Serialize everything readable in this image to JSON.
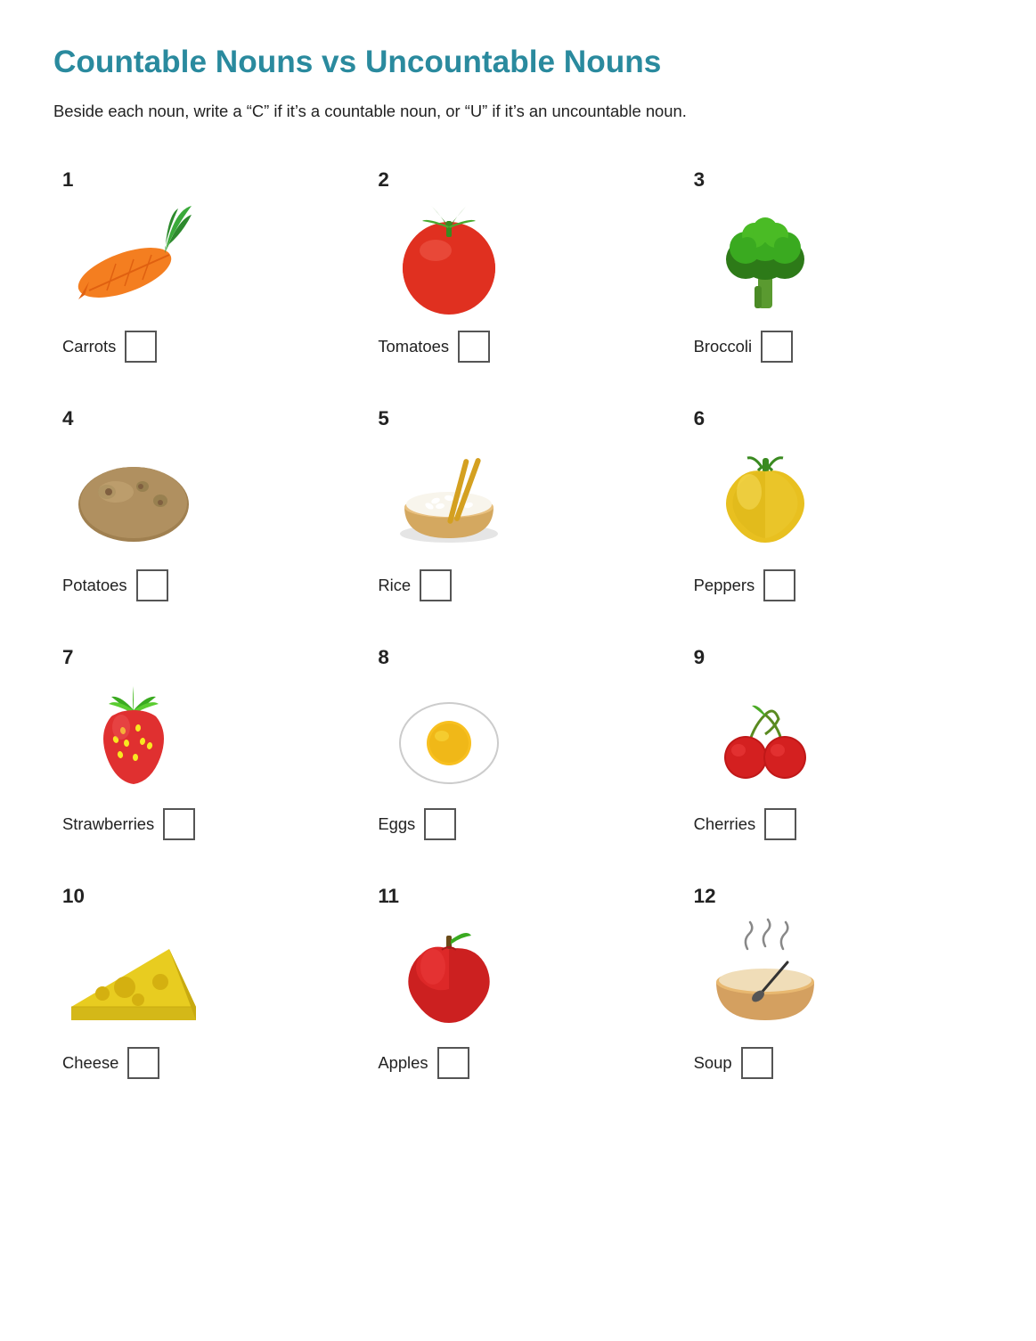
{
  "title": "Countable Nouns vs Uncountable Nouns",
  "instructions": "Beside each noun, write a “C” if it’s a countable noun, or “U” if it’s an uncountable noun.",
  "items": [
    {
      "number": "1",
      "label": "Carrots"
    },
    {
      "number": "2",
      "label": "Tomatoes"
    },
    {
      "number": "3",
      "label": "Broccoli"
    },
    {
      "number": "4",
      "label": "Potatoes"
    },
    {
      "number": "5",
      "label": "Rice"
    },
    {
      "number": "6",
      "label": "Peppers"
    },
    {
      "number": "7",
      "label": "Strawberries"
    },
    {
      "number": "8",
      "label": "Eggs"
    },
    {
      "number": "9",
      "label": "Cherries"
    },
    {
      "number": "10",
      "label": "Cheese"
    },
    {
      "number": "11",
      "label": "Apples"
    },
    {
      "number": "12",
      "label": "Soup"
    }
  ]
}
